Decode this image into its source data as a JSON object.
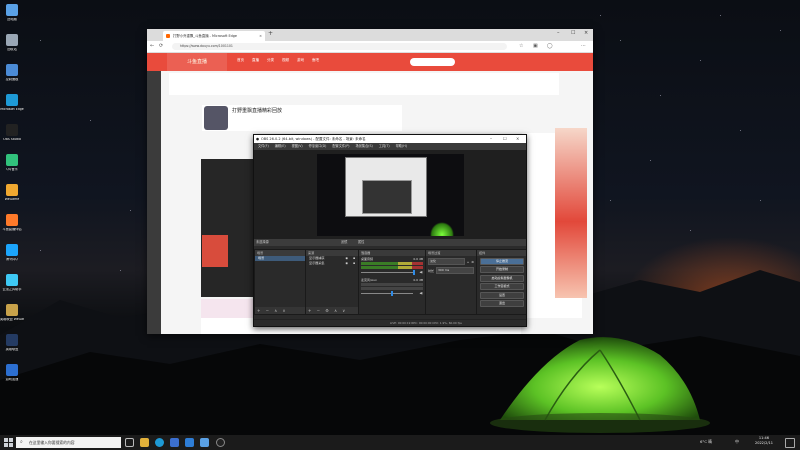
{
  "desktop": {
    "icons": [
      {
        "label": "此电脑",
        "icon": "computer-icon",
        "color": "#5aa1e6"
      },
      {
        "label": "回收站",
        "icon": "recycle-bin-icon",
        "color": "#9aa7b5"
      },
      {
        "label": "控制面板",
        "icon": "control-panel-icon",
        "color": "#4b8bd6"
      },
      {
        "label": "Microsoft Edge",
        "icon": "edge-icon",
        "color": "#1e9ad6"
      },
      {
        "label": "OBS Studio",
        "icon": "obs-icon",
        "color": "#222222"
      },
      {
        "label": "QQ音乐",
        "icon": "qq-music-icon",
        "color": "#31c27c"
      },
      {
        "label": "WeGame",
        "icon": "wegame-icon",
        "color": "#f0a830"
      },
      {
        "label": "斗鱼直播伴侣",
        "icon": "douyu-companion-icon",
        "color": "#ff7a2a"
      },
      {
        "label": "腾讯QQ",
        "icon": "qq-icon",
        "color": "#1ca5fc"
      },
      {
        "label": "云顶之弈助手",
        "icon": "assistant-icon",
        "color": "#3ec9f5"
      },
      {
        "label": "英雄联盟 WeGame版",
        "icon": "lol-icon",
        "color": "#c8a24a"
      },
      {
        "label": "英雄联盟",
        "icon": "lol-client-icon",
        "color": "#243b63"
      },
      {
        "label": "游戏加速",
        "icon": "accelerator-icon",
        "color": "#2c6fd1"
      }
    ]
  },
  "browser": {
    "tab_title": "打野小乔重飘_斗鱼直播 - Microsoft Edge",
    "url": "https://www.douyu.com/1001101",
    "site_nav": [
      "首页",
      "直播",
      "分类",
      "视频",
      "游戏",
      "鱼吧"
    ],
    "stream_title": "打野重飘直播精彩回放",
    "banner_text": "斗鱼直播"
  },
  "obs": {
    "title": "OBS 26.0.2 (64-bit, windows) - 配置文件: 未命名 - 场景: 未命名",
    "menu": [
      "文件(F)",
      "编辑(E)",
      "视图(V)",
      "停靠窗口(D)",
      "配置文件(P)",
      "场景集合(S)",
      "工具(T)",
      "帮助(H)"
    ],
    "scene_bar": {
      "scene": "未选择源",
      "filters": "滤镜",
      "properties": "属性"
    },
    "docks": {
      "scenes": {
        "title": "场景",
        "items": [
          "场景"
        ]
      },
      "sources": {
        "title": "来源",
        "items": [
          "显示器捕获",
          "显示器采集"
        ]
      },
      "mixer": {
        "title": "混音器",
        "tracks": [
          {
            "name": "桌面音频",
            "db": "0.0 dB",
            "level": 0.8
          },
          {
            "name": "麦克风/Aux",
            "db": "0.0 dB",
            "level": 0.0
          }
        ]
      },
      "transitions": {
        "title": "场景过渡",
        "type": "淡化",
        "duration_label": "时长",
        "duration": "300 ms"
      },
      "controls": {
        "title": "控件",
        "buttons": [
          "停止推流",
          "开始录制",
          "启动虚拟摄像机",
          "工作室模式",
          "设置",
          "退出"
        ]
      }
    },
    "status": "LIVE: 00:00:19   REC: 00:00:00   CPU: 1.9%, 60.00 fps"
  },
  "taskbar": {
    "search_placeholder": "在这里输入你要搜索的内容",
    "tray_weather": "6°C 晴",
    "lang": "中",
    "time": "11:46",
    "date": "2022/2/11"
  }
}
